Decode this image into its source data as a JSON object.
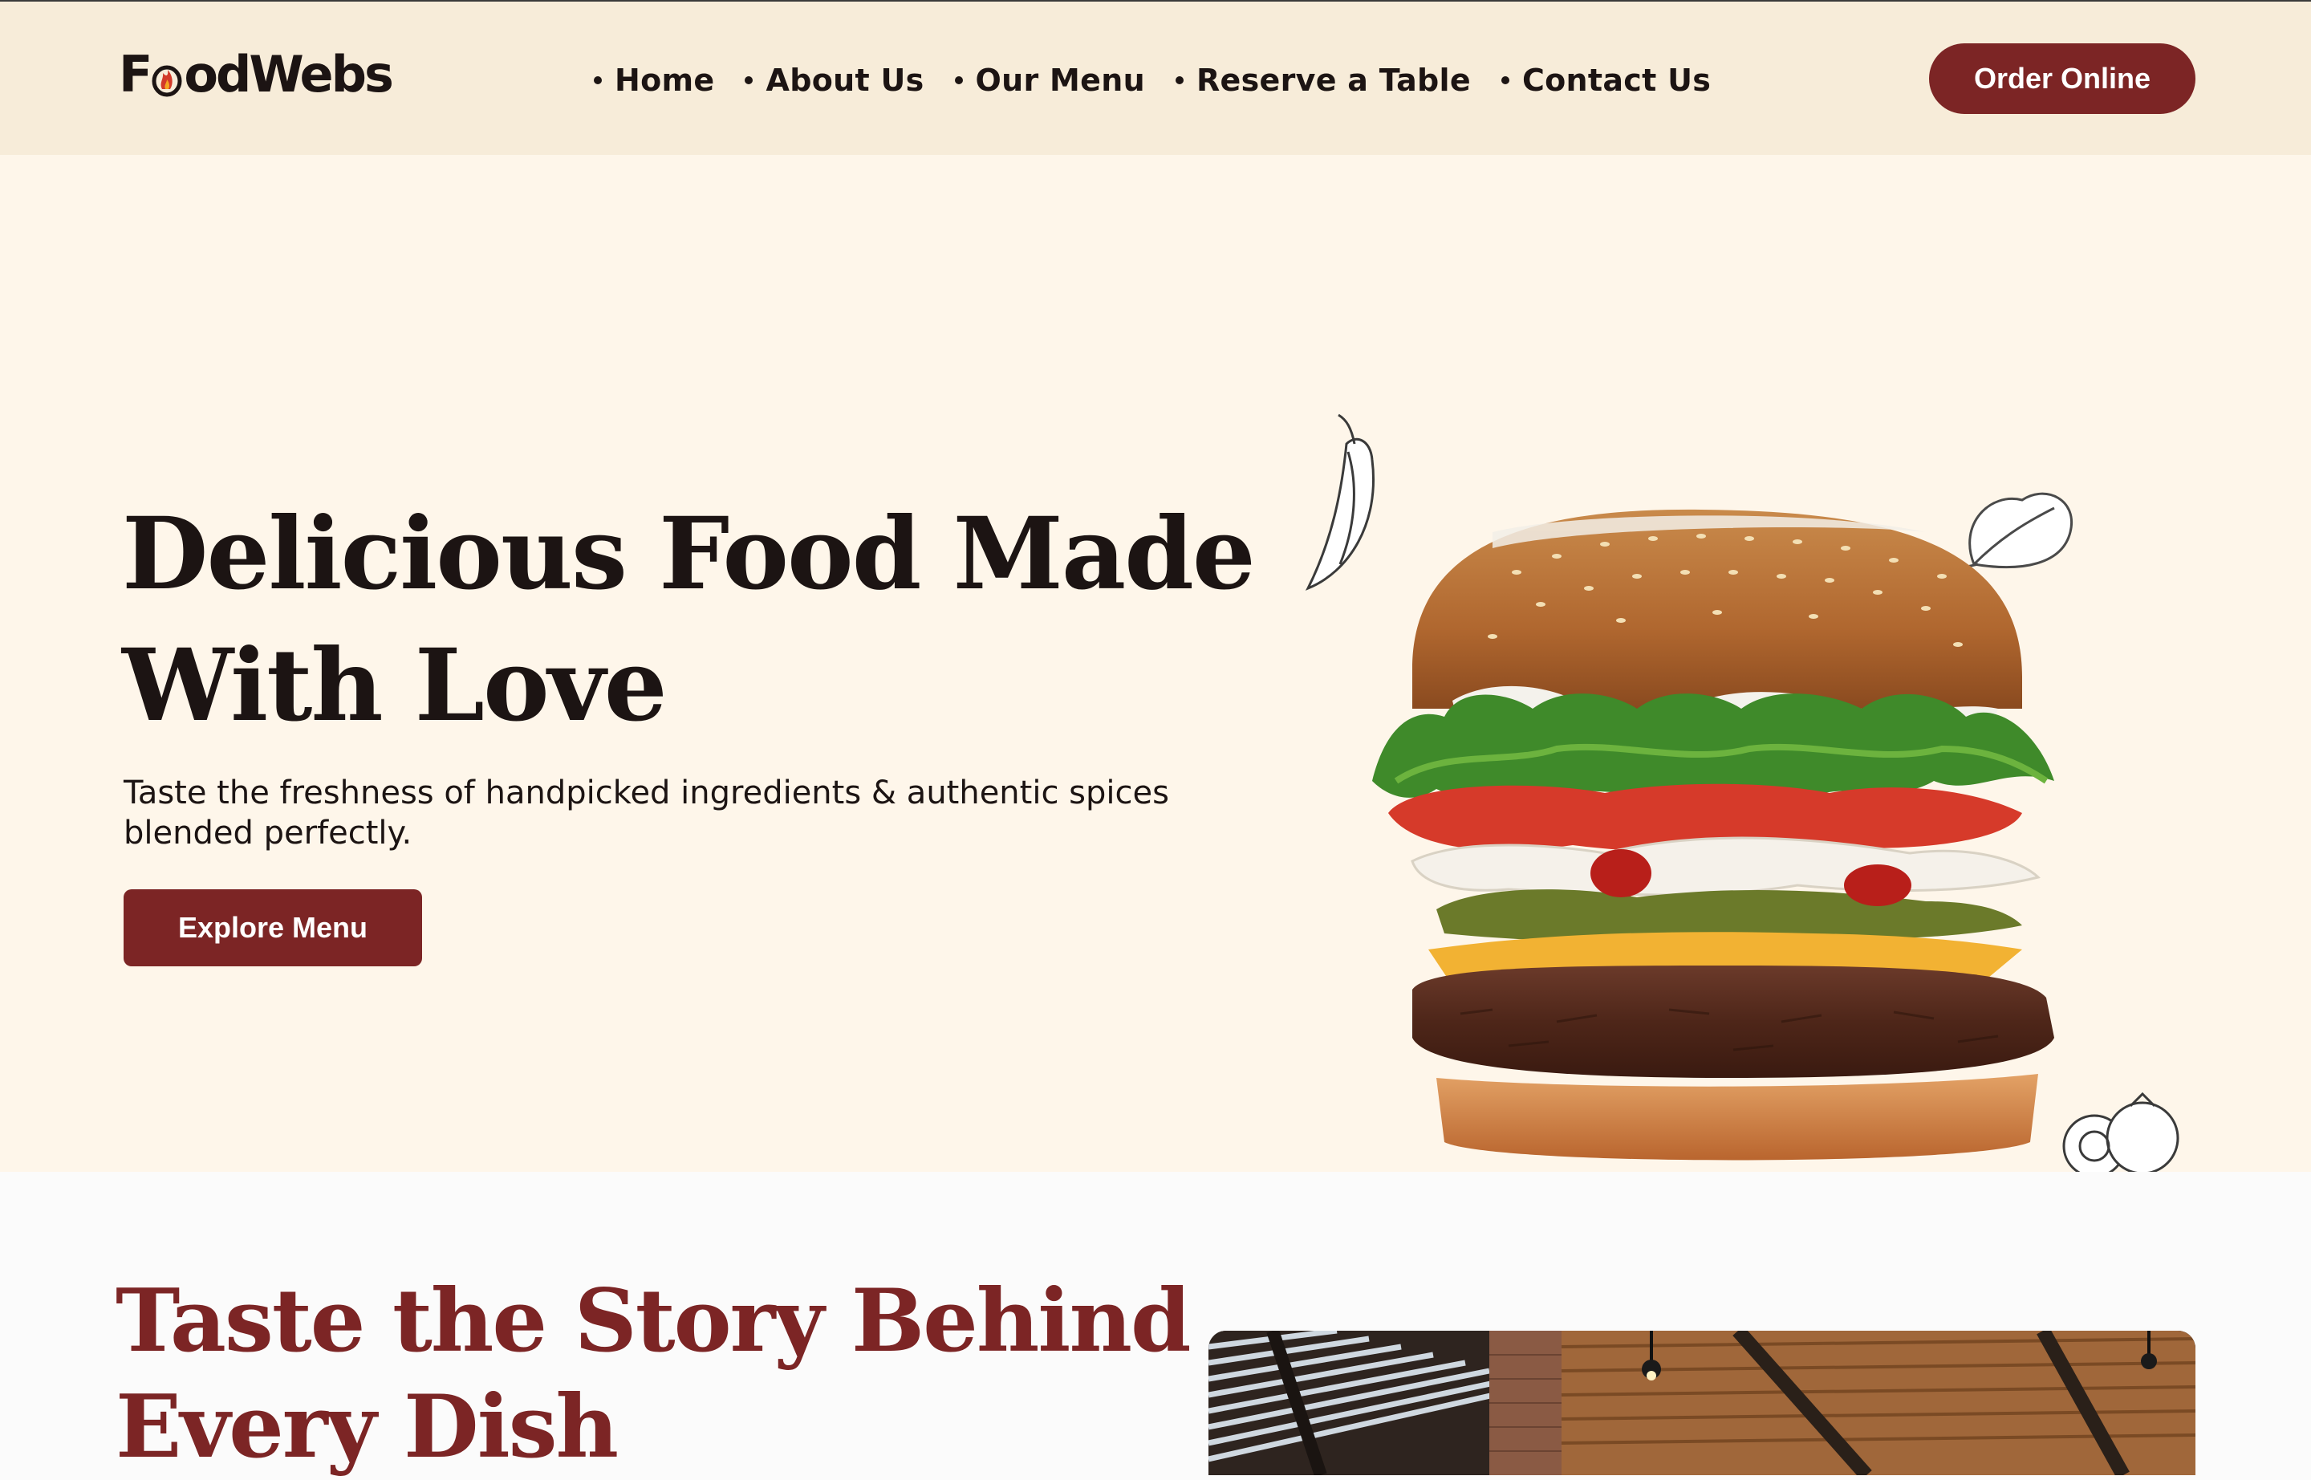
{
  "brand": {
    "logo_text_left": "F",
    "logo_text_right": "odWebs",
    "accent_color": "#7c2525",
    "header_bg": "#f7ecd9",
    "hero_bg": "#fef6ea"
  },
  "nav": {
    "items": [
      {
        "label": "Home"
      },
      {
        "label": "About Us"
      },
      {
        "label": "Our Menu"
      },
      {
        "label": "Reserve a Table"
      },
      {
        "label": "Contact Us"
      }
    ],
    "cta_label": "Order Online"
  },
  "hero": {
    "title_line1": "Delicious Food Made",
    "title_line2": "With Love",
    "subtitle": "Taste the freshness of handpicked ingredients & authentic spices blended perfectly.",
    "button_label": "Explore Menu",
    "image_icon": "burger-illustration"
  },
  "story": {
    "title_line1": "Taste the Story Behind",
    "title_line2": "Every Dish",
    "image_icon": "restaurant-interior-photo"
  }
}
